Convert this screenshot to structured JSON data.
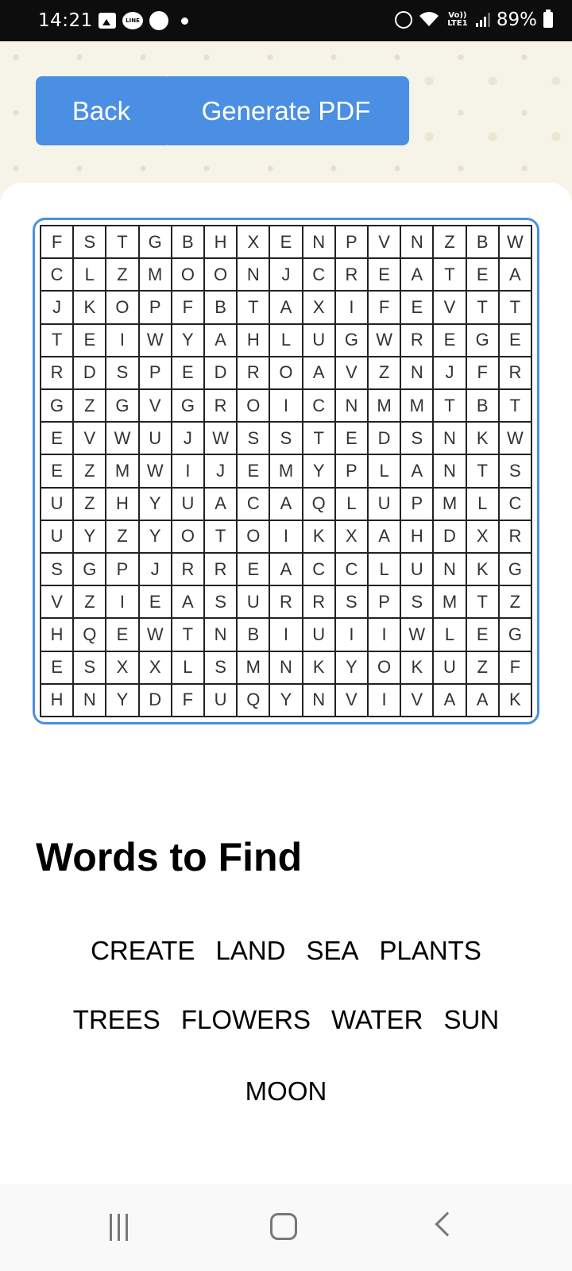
{
  "status_bar": {
    "time": "14:21",
    "line_label": "LINE",
    "lte_label": "Vo)) LTE1",
    "battery": "89%"
  },
  "header": {
    "back_label": "Back",
    "pdf_label": "Generate PDF"
  },
  "grid": [
    [
      "F",
      "S",
      "T",
      "G",
      "B",
      "H",
      "X",
      "E",
      "N",
      "P",
      "V",
      "N",
      "Z",
      "B",
      "W"
    ],
    [
      "C",
      "L",
      "Z",
      "M",
      "O",
      "O",
      "N",
      "J",
      "C",
      "R",
      "E",
      "A",
      "T",
      "E",
      "A"
    ],
    [
      "J",
      "K",
      "O",
      "P",
      "F",
      "B",
      "T",
      "A",
      "X",
      "I",
      "F",
      "E",
      "V",
      "T",
      "T"
    ],
    [
      "T",
      "E",
      "I",
      "W",
      "Y",
      "A",
      "H",
      "L",
      "U",
      "G",
      "W",
      "R",
      "E",
      "G",
      "E"
    ],
    [
      "R",
      "D",
      "S",
      "P",
      "E",
      "D",
      "R",
      "O",
      "A",
      "V",
      "Z",
      "N",
      "J",
      "F",
      "R"
    ],
    [
      "G",
      "Z",
      "G",
      "V",
      "G",
      "R",
      "O",
      "I",
      "C",
      "N",
      "M",
      "M",
      "T",
      "B",
      "T"
    ],
    [
      "E",
      "V",
      "W",
      "U",
      "J",
      "W",
      "S",
      "S",
      "T",
      "E",
      "D",
      "S",
      "N",
      "K",
      "W"
    ],
    [
      "E",
      "Z",
      "M",
      "W",
      "I",
      "J",
      "E",
      "M",
      "Y",
      "P",
      "L",
      "A",
      "N",
      "T",
      "S"
    ],
    [
      "U",
      "Z",
      "H",
      "Y",
      "U",
      "A",
      "C",
      "A",
      "Q",
      "L",
      "U",
      "P",
      "M",
      "L",
      "C"
    ],
    [
      "U",
      "Y",
      "Z",
      "Y",
      "O",
      "T",
      "O",
      "I",
      "K",
      "X",
      "A",
      "H",
      "D",
      "X",
      "R"
    ],
    [
      "S",
      "G",
      "P",
      "J",
      "R",
      "R",
      "E",
      "A",
      "C",
      "C",
      "L",
      "U",
      "N",
      "K",
      "G"
    ],
    [
      "V",
      "Z",
      "I",
      "E",
      "A",
      "S",
      "U",
      "R",
      "R",
      "S",
      "P",
      "S",
      "M",
      "T",
      "Z"
    ],
    [
      "H",
      "Q",
      "E",
      "W",
      "T",
      "N",
      "B",
      "I",
      "U",
      "I",
      "I",
      "W",
      "L",
      "E",
      "G"
    ],
    [
      "E",
      "S",
      "X",
      "X",
      "L",
      "S",
      "M",
      "N",
      "K",
      "Y",
      "O",
      "K",
      "U",
      "Z",
      "F"
    ],
    [
      "H",
      "N",
      "Y",
      "D",
      "F",
      "U",
      "Q",
      "Y",
      "N",
      "V",
      "I",
      "V",
      "A",
      "A",
      "K"
    ]
  ],
  "words_title": "Words to Find",
  "words": [
    "CREATE",
    "LAND",
    "SEA",
    "PLANTS",
    "TREES",
    "FLOWERS",
    "WATER",
    "SUN",
    "MOON"
  ],
  "colors": {
    "accent": "#4a8fe3",
    "status_bar": "#0d0d0d"
  }
}
